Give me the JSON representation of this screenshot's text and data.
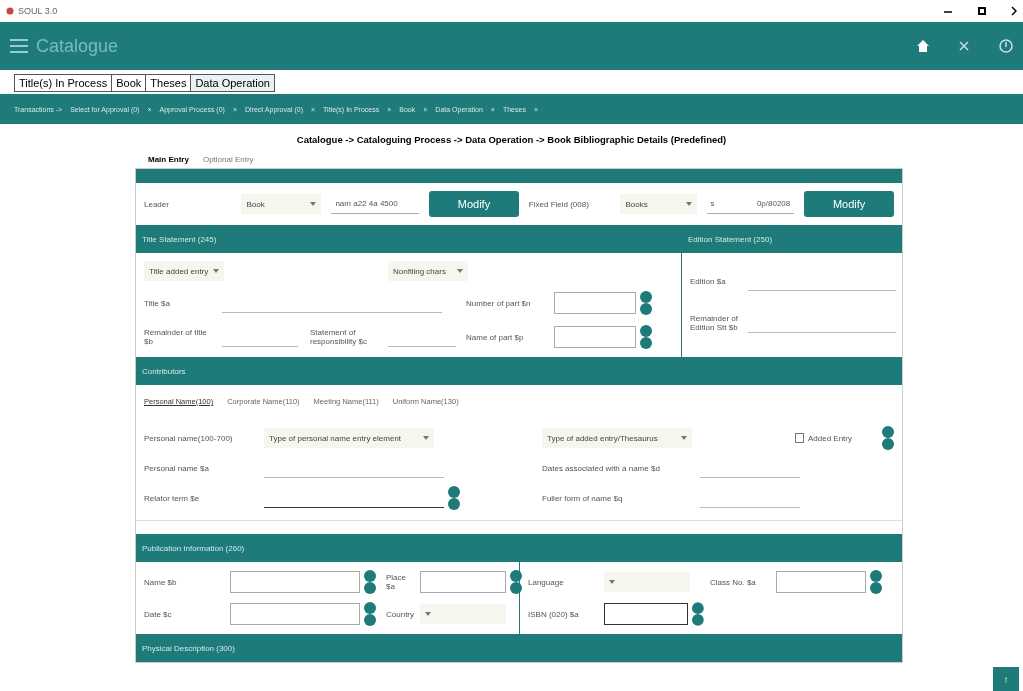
{
  "window": {
    "title": "SOUL 3.0"
  },
  "header": {
    "title": "Catalogue"
  },
  "tabs": [
    {
      "label": "Title(s) In Process",
      "selected": false
    },
    {
      "label": "Book",
      "selected": false
    },
    {
      "label": "Theses",
      "selected": false
    },
    {
      "label": "Data Operation",
      "selected": true
    }
  ],
  "nav": {
    "lead": "Transactions ->",
    "items": [
      "Select for Approval (0)",
      "Approval Process (0)",
      "Direct Approval (0)",
      "Title(s) In Process",
      "Book",
      "Data Operation",
      "Theses"
    ],
    "close": "×"
  },
  "breadcrumb": "Catalogue -> Cataloguing Process -> Data Operation -> Book Bibliographic Details (Predefined)",
  "entry_tabs": [
    {
      "label": "Main Entry",
      "selected": true
    },
    {
      "label": "Optional Entry",
      "selected": false
    }
  ],
  "leader": {
    "label": "Leader",
    "select": "Book",
    "value": "nam a22   4a 4500",
    "button": "Modify"
  },
  "fixed_field": {
    "label": "Fixed Field (008)",
    "select": "Books",
    "value_1": "s",
    "value_2": "0p/80208",
    "button": "Modify"
  },
  "title_statement": {
    "title": "Title Statement (245)",
    "selects": [
      "Title added entry",
      "Nonfiling chars"
    ],
    "fields": [
      {
        "label": "Title $a",
        "kind": "line"
      },
      {
        "label": "Number of part $n",
        "kind": "box"
      },
      {
        "label": "Remainder of title $b",
        "kind": "line"
      },
      {
        "label": "Statement of responsibility $c",
        "kind": "line"
      },
      {
        "label": "Name of part $p",
        "kind": "box"
      }
    ]
  },
  "edition_statement": {
    "title": "Edition Statement (250)",
    "fields": [
      {
        "label": "Edition $a"
      },
      {
        "label": "Remainder of Edition Stt $b"
      }
    ]
  },
  "contributors": {
    "title": "Contributors",
    "tabs": [
      {
        "label": "Personal Name(100)",
        "selected": true
      },
      {
        "label": "Corporate Name(110)",
        "selected": false
      },
      {
        "label": "Meeting Name(111)",
        "selected": false
      },
      {
        "label": "Uniform Name(130)",
        "selected": false
      }
    ],
    "name_label": "Personal name(100-700)",
    "selects": [
      "Type of personal name entry element",
      "Type of added entry/Thesaurus"
    ],
    "added_entry": {
      "label": "Added Entry",
      "checked": false
    },
    "fields": [
      {
        "label": "Personal name $a",
        "kind": "line"
      },
      {
        "label": "Dates associated with a name $d",
        "kind": "line"
      },
      {
        "label": "Relator term $e",
        "kind": "active"
      },
      {
        "label": "Fuller form of name $q",
        "kind": "line"
      }
    ]
  },
  "publication": {
    "title": "Publication Information (260)",
    "fields": [
      {
        "label": "Name $b",
        "kind": "box"
      },
      {
        "label": "Place $a",
        "kind": "box"
      },
      {
        "label": "Language",
        "kind": "select"
      },
      {
        "label": "Class No. $a",
        "kind": "box"
      },
      {
        "label": "Date $c",
        "kind": "box"
      },
      {
        "label": "Country",
        "kind": "select"
      },
      {
        "label": "ISBN (020) $a",
        "kind": "dark"
      }
    ]
  },
  "next_section": {
    "title": "Physical Description (300)"
  },
  "scroll_top": "↑"
}
